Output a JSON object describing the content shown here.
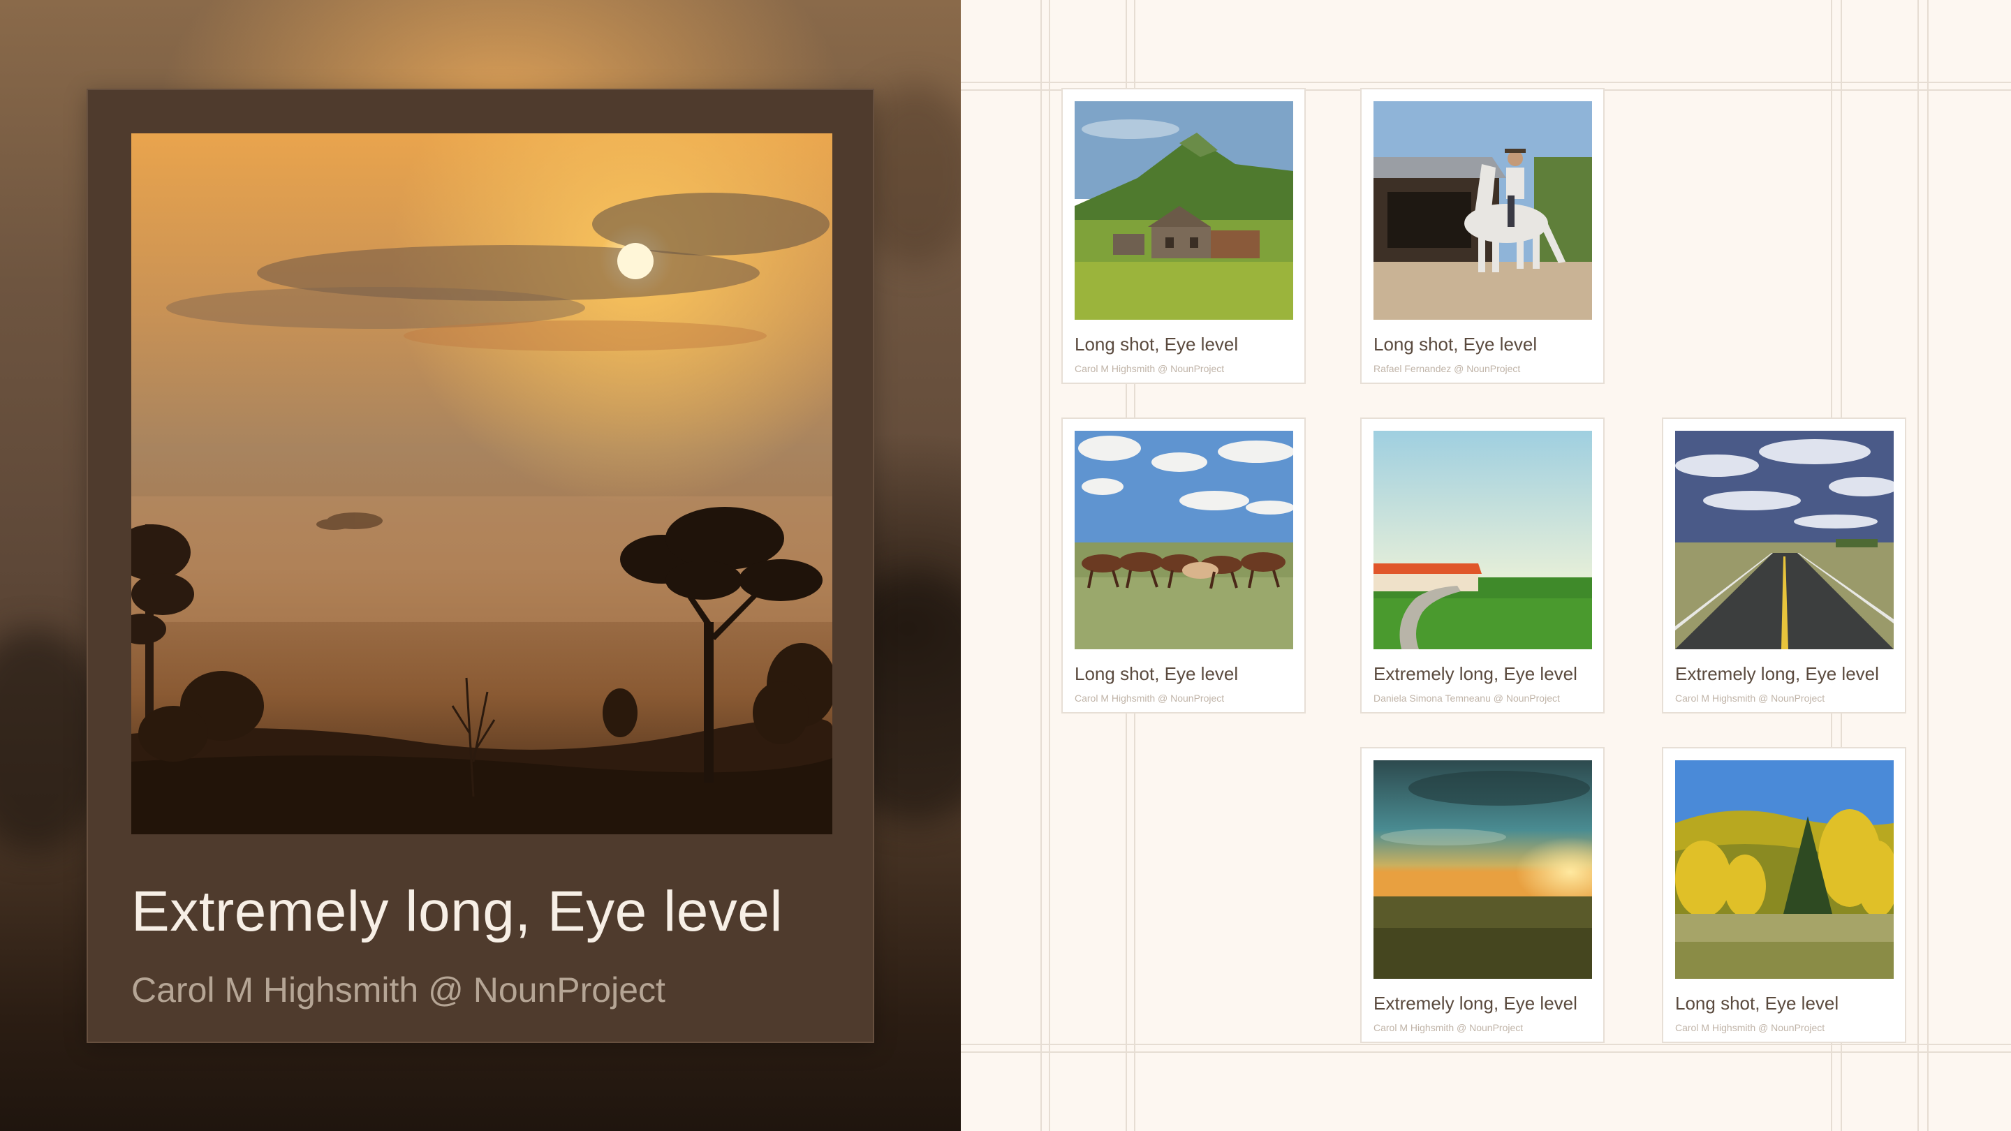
{
  "feature": {
    "title": "Extremely long, Eye level",
    "credit": "Carol M Highsmith @ NounProject",
    "image": "foggy-savanna-sunrise"
  },
  "cards": [
    {
      "title": "Long shot, Eye level",
      "credit": "Carol M Highsmith @ NounProject",
      "image": "mountain-cabin"
    },
    {
      "title": "Long shot, Eye level",
      "credit": "Rafael Fernandez @ NounProject",
      "image": "horse-rider-barn"
    },
    {
      "title": "Long shot, Eye level",
      "credit": "Carol M Highsmith @ NounProject",
      "image": "running-horses"
    },
    {
      "title": "Extremely long, Eye level",
      "credit": "Daniela Simona Temneanu @ NounProject",
      "image": "green-field-barn"
    },
    {
      "title": "Extremely long, Eye level",
      "credit": "Carol M Highsmith @ NounProject",
      "image": "open-highway"
    },
    {
      "title": "Extremely long, Eye level",
      "credit": "Carol M Highsmith @ NounProject",
      "image": "prairie-sunset"
    },
    {
      "title": "Long shot, Eye level",
      "credit": "Carol M Highsmith @ NounProject",
      "image": "autumn-aspens"
    }
  ]
}
